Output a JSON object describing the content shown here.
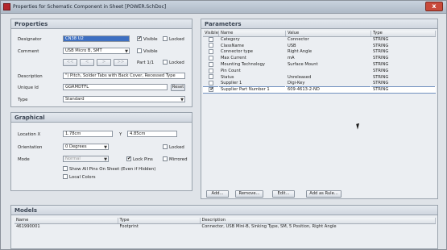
{
  "window": {
    "title": "Properties for Schematic Component in Sheet [POWER.SchDoc]",
    "close_glyph": "x"
  },
  "properties": {
    "header": "Properties",
    "designator_label": "Designator",
    "designator_value": "CN38 U2",
    "visible_label": "Visible",
    "locked_label": "Locked",
    "comment_label": "Comment",
    "comment_value": "USB Micro B, SMT",
    "part_label": "Part 1/1",
    "nav_buttons": [
      "<<",
      "<",
      ">",
      ">>"
    ],
    "description_label": "Description",
    "description_value": "\") Pitch, Solder Tabs with Back Cover, Recessed Type",
    "unique_id_label": "Unique Id",
    "unique_id_value": "GGRMDTFL",
    "reset_label": "Reset",
    "type_label": "Type",
    "type_value": "Standard"
  },
  "graphical": {
    "header": "Graphical",
    "location_label": "Location  X",
    "x_value": "1.78cm",
    "y_label": "Y",
    "y_value": "4.85cm",
    "orientation_label": "Orientation",
    "orientation_value": "0 Degrees",
    "locked_label": "Locked",
    "mode_label": "Mode",
    "mode_value": "Normal",
    "lock_pins_label": "Lock Pins",
    "mirrored_label": "Mirrored",
    "show_all_pins_label": "Show All Pins On Sheet (Even if Hidden)",
    "local_colors_label": "Local Colors"
  },
  "parameters": {
    "header": "Parameters",
    "columns": [
      "Visible",
      "Name",
      "Value",
      "Type"
    ],
    "rows": [
      {
        "visible": false,
        "name": "Category",
        "value": "Connector",
        "type": "STRING"
      },
      {
        "visible": false,
        "name": "ClassName",
        "value": "USB",
        "type": "STRING"
      },
      {
        "visible": false,
        "name": "Connector type",
        "value": "Right Angle",
        "type": "STRING"
      },
      {
        "visible": false,
        "name": "Max Current",
        "value": "mA",
        "type": "STRING"
      },
      {
        "visible": false,
        "name": "Mounting Technology",
        "value": "Surface Mount",
        "type": "STRING"
      },
      {
        "visible": false,
        "name": "Pin Count",
        "value": "",
        "type": "STRING"
      },
      {
        "visible": false,
        "name": "Status",
        "value": "Unreleased",
        "type": "STRING"
      },
      {
        "visible": false,
        "name": "Supplier 1",
        "value": "Digi-Key",
        "type": "STRING"
      },
      {
        "visible": true,
        "name": "Supplier Part Number 1",
        "value": "609-4613-2-ND",
        "type": "STRING"
      }
    ],
    "buttons": [
      "Add...",
      "Remove...",
      "Edit...",
      "Add as Rule..."
    ]
  },
  "models": {
    "header": "Models",
    "columns": [
      "Name",
      "Type",
      "Description"
    ],
    "rows": [
      {
        "name": "461990001",
        "type": "Footprint",
        "description": "Connector, USB Mini-B, Sinking Type, SM, 5 Position, Right Angle"
      }
    ]
  }
}
